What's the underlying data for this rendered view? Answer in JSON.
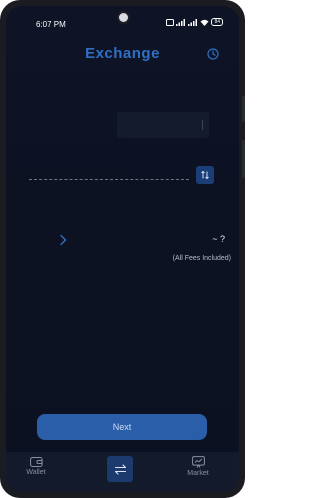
{
  "status_bar": {
    "time": "6:07 PM",
    "battery": "84"
  },
  "header": {
    "title": "Exchange",
    "history_icon": "clock-icon"
  },
  "exchange": {
    "swap_icon": "swap-vertical-icon",
    "estimate": "~ ?",
    "fees_note": "(All Fees Included)"
  },
  "actions": {
    "next_label": "Next"
  },
  "bottom_nav": {
    "items": [
      {
        "label": "Wallet",
        "icon": "wallet-icon"
      },
      {
        "label": "",
        "icon": "swap-horizontal-icon"
      },
      {
        "label": "Market",
        "icon": "chart-icon"
      }
    ]
  },
  "colors": {
    "accent": "#2f6fc4",
    "button": "#2a5ea8",
    "background": "#0c1222"
  }
}
